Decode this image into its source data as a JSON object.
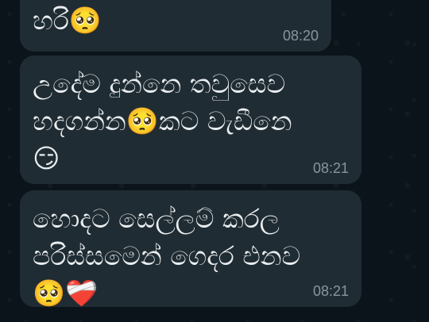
{
  "messages": [
    {
      "text": "හරි🥺",
      "time": "08:20"
    },
    {
      "text": "උදේම දුන්නෙ තවුසෙව\nහදගන්න🥺කට වැඩීනෙ\n😏",
      "time": "08:21"
    },
    {
      "text": "හොදට සෙල්ලම් කරල\nපරිස්සමෙන් ගෙදර එනව\n🥺❤️‍🩹",
      "time": "08:21"
    }
  ],
  "colors": {
    "background": "#0b141a",
    "bubble": "#202c33",
    "text": "#e9edef",
    "timestamp": "#8696a0"
  }
}
